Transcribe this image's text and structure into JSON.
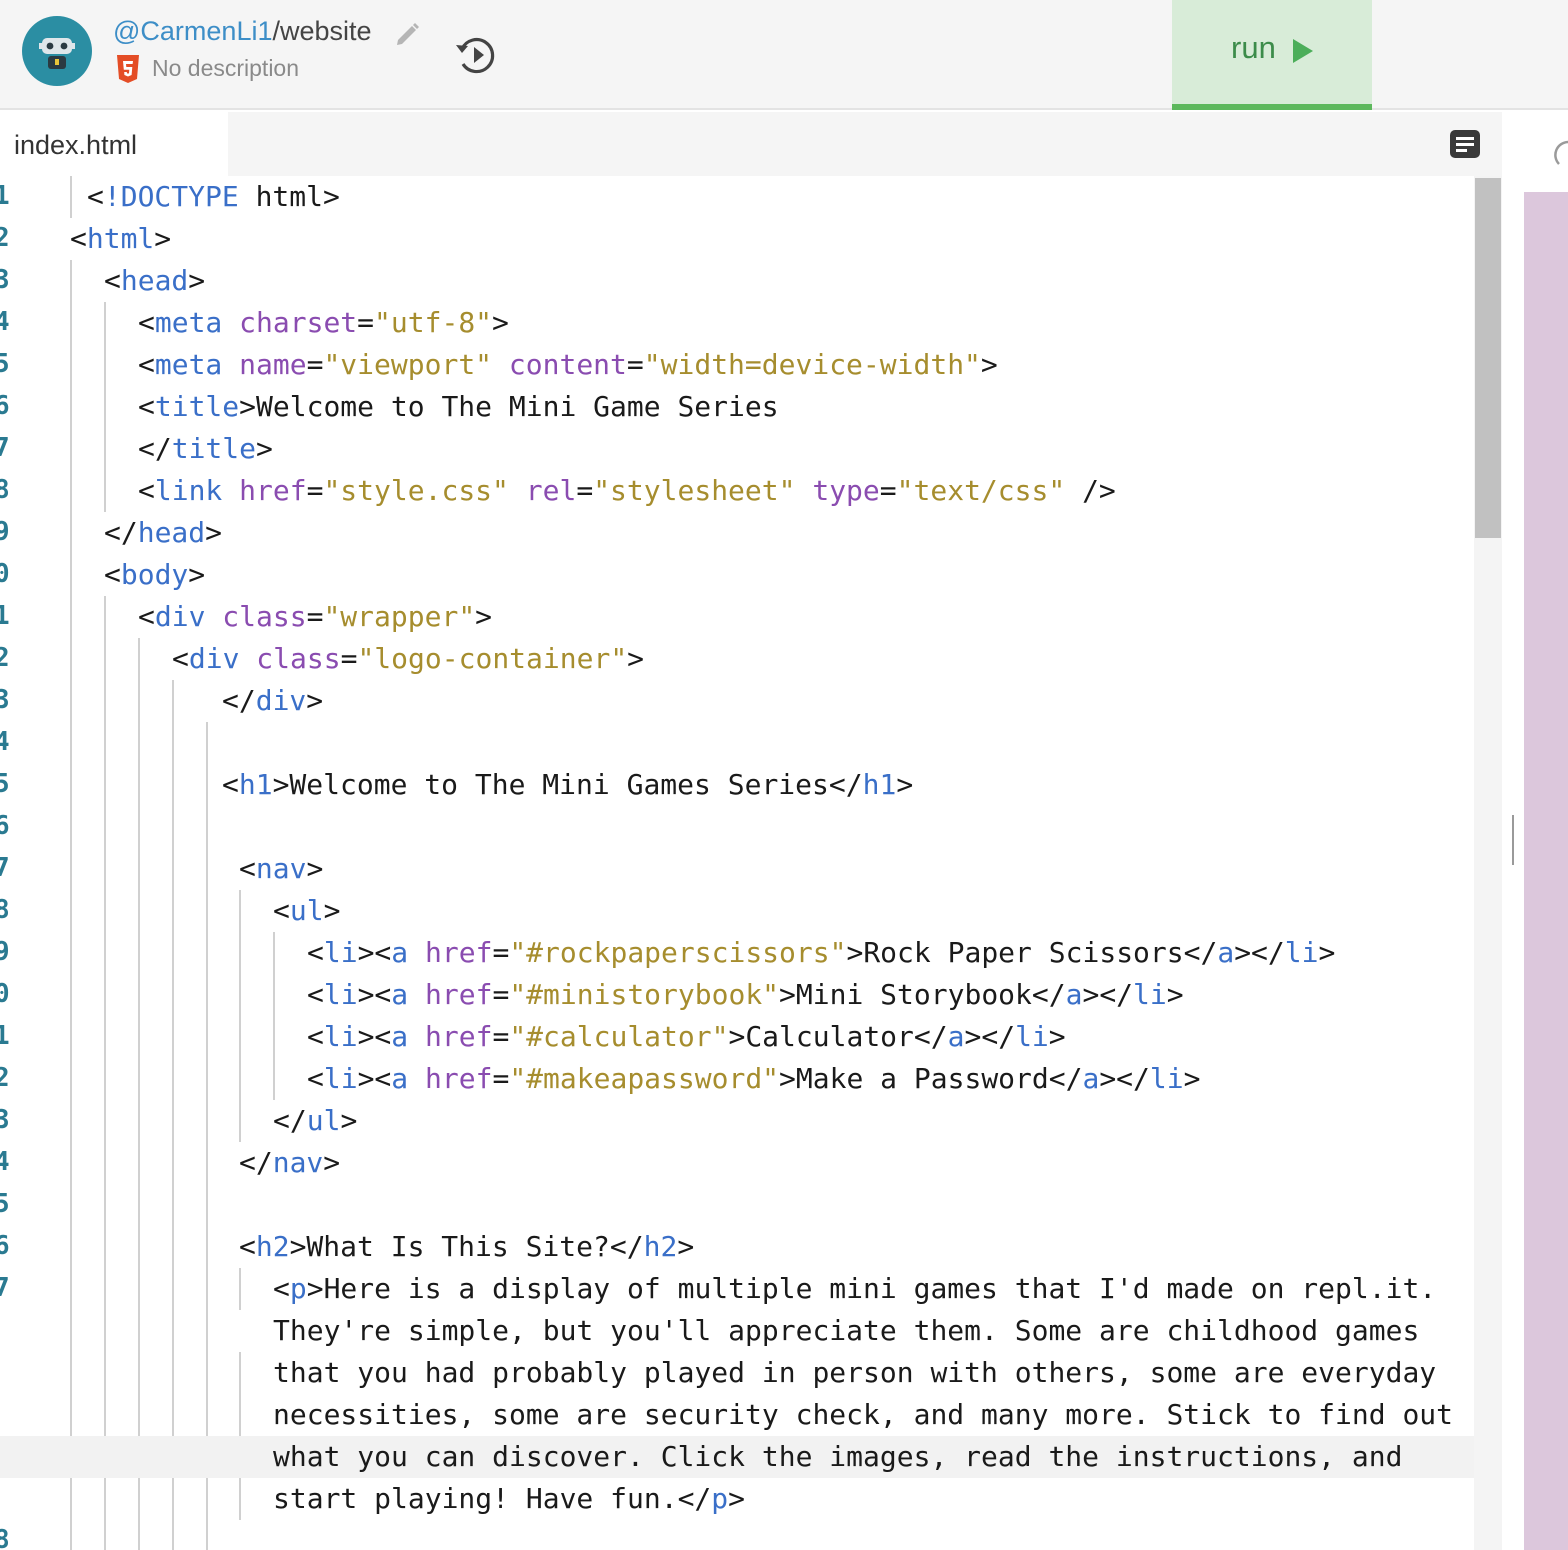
{
  "header": {
    "owner": "@CarmenLi1",
    "separator": "/",
    "repl_name": "website",
    "description": "No description",
    "run_label": "run"
  },
  "editor": {
    "tab_label": "index.html",
    "lines": [
      {
        "n": "1",
        "code": "<!DOCTYPE html>"
      },
      {
        "n": "2",
        "code": "<html>"
      },
      {
        "n": "3",
        "code": "<head>"
      },
      {
        "n": "4",
        "code": "<meta charset=\"utf-8\">"
      },
      {
        "n": "5",
        "code": "<meta name=\"viewport\" content=\"width=device-width\">"
      },
      {
        "n": "6",
        "code": "<title>Welcome to The Mini Game Series"
      },
      {
        "n": "7",
        "code": "</title>"
      },
      {
        "n": "8",
        "code": "<link href=\"style.css\" rel=\"stylesheet\" type=\"text/css\" />"
      },
      {
        "n": "9",
        "code": "</head>"
      },
      {
        "n": "0",
        "code": "<body>"
      },
      {
        "n": "1",
        "code": "<div class=\"wrapper\">"
      },
      {
        "n": "2",
        "code": "<div class=\"logo-container\">"
      },
      {
        "n": "3",
        "code": "</div>"
      },
      {
        "n": "4",
        "code": ""
      },
      {
        "n": "5",
        "code": "<h1>Welcome to The Mini Games Series</h1>"
      },
      {
        "n": "6",
        "code": ""
      },
      {
        "n": "7",
        "code": "<nav>"
      },
      {
        "n": "8",
        "code": "<ul>"
      },
      {
        "n": "9",
        "code": "<li><a href=\"#rockpaperscissors\">Rock Paper Scissors</a></li>"
      },
      {
        "n": "0",
        "code": "<li><a href=\"#ministorybook\">Mini Storybook</a></li>"
      },
      {
        "n": "1",
        "code": "<li><a href=\"#calculator\">Calculator</a></li>"
      },
      {
        "n": "2",
        "code": "<li><a href=\"#makeapassword\">Make a Password</a></li>"
      },
      {
        "n": "3",
        "code": "</ul>"
      },
      {
        "n": "4",
        "code": "</nav>"
      },
      {
        "n": "5",
        "code": ""
      },
      {
        "n": "6",
        "code": "<h2>What Is This Site?</h2>"
      },
      {
        "n": "7",
        "code": "<p>Here is a display of multiple mini games that I'd made on repl.it."
      },
      {
        "n": "",
        "code": "They're simple, but you'll appreciate them. Some are childhood games"
      },
      {
        "n": "",
        "code": "that you had probably played in person with others, some are everyday"
      },
      {
        "n": "",
        "code": "necessities, some are security check, and many more. Stick to find out"
      },
      {
        "n": "",
        "code": "what you can discover. Click the images, read the instructions, and"
      },
      {
        "n": "",
        "code": "start playing! Have fun.</p>"
      },
      {
        "n": "8",
        "code": ""
      }
    ]
  }
}
